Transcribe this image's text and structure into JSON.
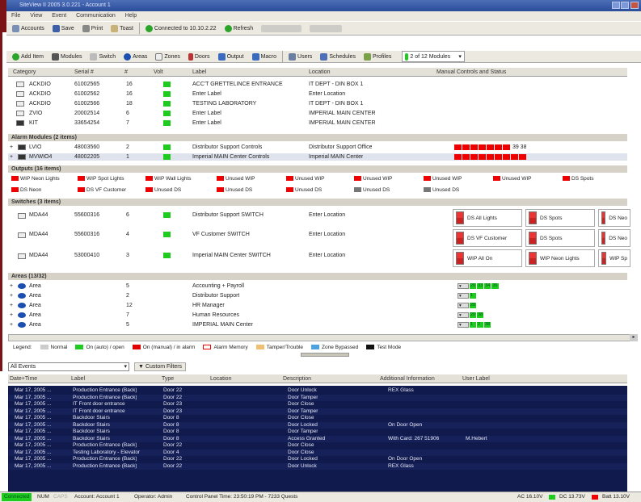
{
  "window": {
    "title": "SiteView II 2005 3.0.221 - Account 1"
  },
  "menu": [
    "File",
    "View",
    "Event",
    "Communication",
    "Help"
  ],
  "toolbar1": {
    "accounts": "Accounts",
    "save": "Save",
    "print": "Print",
    "toast": "Toast",
    "connected": "Connected to 10.10.2.22",
    "refresh": "Refresh",
    "disabled_a": "",
    "disabled_b": ""
  },
  "toolbar2": {
    "add_item": "Add Item",
    "modules": "Modules",
    "switch": "Switch",
    "areas": "Areas",
    "zones": "Zones",
    "doors": "Doors",
    "output": "Output",
    "macro": "Macro",
    "users": "Users",
    "schedules": "Schedules",
    "profiles": "Profiles",
    "module_select": "2 of 12 Modules"
  },
  "grid": {
    "headers": {
      "category": "Category",
      "serial": "Serial #",
      "num": "#",
      "volt": "Volt",
      "label": "Label",
      "location": "Location",
      "manual": "Manual Controls and Status"
    },
    "devices": [
      {
        "cat": "ACKDIO",
        "serial": "61002565",
        "num": "16",
        "label": "ACC'T GRETTELINCE ENTRANCE",
        "loc": "IT DEPT - DIN BOX 1"
      },
      {
        "cat": "ACKDIO",
        "serial": "61002562",
        "num": "16",
        "label": "Enter Label",
        "loc": "Enter Location"
      },
      {
        "cat": "ACKDIO",
        "serial": "61002566",
        "num": "18",
        "label": "TESTING LABORATORY",
        "loc": "IT DEPT - DIN BOX 1"
      },
      {
        "cat": "ZVIO",
        "serial": "20002514",
        "num": "6",
        "label": "Enter Label",
        "loc": "IMPERIAL MAIN CENTER"
      },
      {
        "cat": "KIT",
        "serial": "33654254",
        "num": "7",
        "label": "Enter Label",
        "loc": "IMPERIAL MAIN CENTER"
      }
    ],
    "alarm_section": "Alarm Modules (2 items)",
    "alarms": [
      {
        "cat": "LVIO",
        "serial": "48003560",
        "num": "2",
        "label": "Distributor Support Controls",
        "loc": "Distributor Support Office",
        "status": "39 38"
      },
      {
        "cat": "MVWIO4",
        "serial": "48002205",
        "num": "1",
        "label": "Imperial MAIN Center Controls",
        "loc": "Imperial MAIN Center"
      }
    ],
    "outputs_section": "Outputs (16 items)",
    "outputs_row1": [
      "WIP Neon Lights",
      "WIP Spot Lights",
      "WIP Wall Lights",
      "Unused WIP",
      "Unused WIP",
      "Unused WIP",
      "Unused WIP",
      "Unused WIP",
      "DS Spots"
    ],
    "outputs_row2": [
      "DS Neon",
      "DS VF Customer",
      "Unused DS",
      "Unused DS",
      "Unused DS",
      "Unused DS",
      "Unused DS"
    ],
    "switches_section": "Switches (3 items)",
    "switches": [
      {
        "cat": "MDA44",
        "serial": "55600316",
        "num": "6",
        "label": "Distributor Support SWITCH",
        "loc": "Enter Location",
        "cards": [
          "DS All Lights",
          "DS Spots",
          "DS Neo"
        ]
      },
      {
        "cat": "MDA44",
        "serial": "55600316",
        "num": "4",
        "label": "VF Customer SWITCH",
        "loc": "Enter Location",
        "cards": [
          "DS VF Customer",
          "DS Spots",
          "DS Neo"
        ]
      },
      {
        "cat": "MDA44",
        "serial": "53000410",
        "num": "3",
        "label": "Imperial MAIN Center SWITCH",
        "loc": "Enter Location",
        "cards": [
          "WIP All On",
          "WIP Neon Lights",
          "WIP Sp"
        ]
      }
    ],
    "areas_section": "Areas (13/32)",
    "areas": [
      {
        "cat": "Area",
        "num": "5",
        "label": "Accounting + Payroll",
        "levels": [
          "20",
          "33",
          "34",
          "35"
        ]
      },
      {
        "cat": "Area",
        "num": "2",
        "label": "Distributor Support",
        "levels": [
          "1"
        ]
      },
      {
        "cat": "Area",
        "num": "12",
        "label": "HR Manager",
        "levels": [
          "20"
        ]
      },
      {
        "cat": "Area",
        "num": "7",
        "label": "Human Resources",
        "levels": [
          "20",
          "38"
        ]
      },
      {
        "cat": "Area",
        "num": "5",
        "label": "IMPERIAL MAIN Center",
        "levels": [
          "1",
          "2",
          "38"
        ]
      }
    ]
  },
  "legend": [
    {
      "label": "Normal",
      "color": "#cccccc"
    },
    {
      "label": "On (auto) / open",
      "color": "#1ecb1e"
    },
    {
      "label": "On (manual) / in alarm",
      "color": "#e00000"
    },
    {
      "label": "Alarm Memory",
      "color": "#ffffff"
    },
    {
      "label": "Tamper/Trouble",
      "color": "#f0c070"
    },
    {
      "label": "Zone Bypassed",
      "color": "#4aa3e0"
    },
    {
      "label": "Test Mode",
      "color": "#111111"
    }
  ],
  "events": {
    "filter": "All Events",
    "custom_filters": "Custom Filters",
    "headers": {
      "date": "Date+Time",
      "label": "Label",
      "type": "Type",
      "location": "Location",
      "description": "Description",
      "additional": "Additional Information",
      "user": "User Label"
    },
    "rows": [
      {
        "date": "Mar 17, 2005 ...",
        "label": "Production Entrance (Back)",
        "type": "Door 22",
        "desc": "Door Unlock",
        "add": "REX Glass",
        "user": ""
      },
      {
        "date": "Mar 17, 2005 ...",
        "label": "Production Entrance (Back)",
        "type": "Door 22",
        "desc": "Door Tamper",
        "add": "",
        "user": ""
      },
      {
        "date": "Mar 17, 2005 ...",
        "label": "IT Front door entrance",
        "type": "Door 23",
        "desc": "Door Close",
        "add": "",
        "user": ""
      },
      {
        "date": "Mar 17, 2005 ...",
        "label": "IT Front door entrance",
        "type": "Door 23",
        "desc": "Door Tamper",
        "add": "",
        "user": ""
      },
      {
        "date": "Mar 17, 2005 ...",
        "label": "Backdoor Stairs",
        "type": "Door 8",
        "desc": "Door Close",
        "add": "",
        "user": ""
      },
      {
        "date": "Mar 17, 2005 ...",
        "label": "Backdoor Stairs",
        "type": "Door 8",
        "desc": "Door Locked",
        "add": "On Door Open",
        "user": ""
      },
      {
        "date": "Mar 17, 2005 ...",
        "label": "Backdoor Stairs",
        "type": "Door 8",
        "desc": "Door Tamper",
        "add": "",
        "user": ""
      },
      {
        "date": "Mar 17, 2005 ...",
        "label": "Backdoor Stairs",
        "type": "Door 8",
        "desc": "Access Granted",
        "add": "With Card: 267 51906",
        "user": "M.Hebert"
      },
      {
        "date": "Mar 17, 2005 ...",
        "label": "Production Entrance (Back)",
        "type": "Door 22",
        "desc": "Door Close",
        "add": "",
        "user": ""
      },
      {
        "date": "Mar 17, 2005 ...",
        "label": "Testing Laboratory - Elevator",
        "type": "Door 4",
        "desc": "Door Close",
        "add": "",
        "user": ""
      },
      {
        "date": "Mar 17, 2005 ...",
        "label": "Production Entrance (Back)",
        "type": "Door 22",
        "desc": "Door Locked",
        "add": "On Door Open",
        "user": ""
      },
      {
        "date": "Mar 17, 2005 ...",
        "label": "Production Entrance (Back)",
        "type": "Door 22",
        "desc": "Door Unlock",
        "add": "REX Glass",
        "user": ""
      }
    ]
  },
  "status": {
    "connected": "Connected",
    "num": "NUM",
    "caps": "CAPS",
    "account": "Account: Account 1",
    "operator": "Operator: Admin",
    "panel_time": "Control Panel Time: 23:50:19 PM - 7233 Quests",
    "ac": "AC 16.10V",
    "dc": "DC 13.73V",
    "batt": "Batt 13.10V"
  }
}
